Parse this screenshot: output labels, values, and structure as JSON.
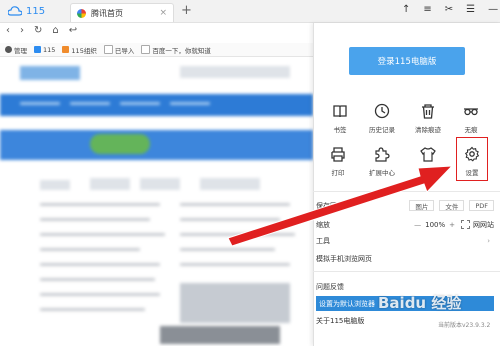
{
  "tabstrip": {
    "brand": "115",
    "tab_title": "腾讯首页",
    "tab_close": "×",
    "new_tab": "+",
    "window_controls": [
      "↑",
      "≡",
      "✂",
      "☰",
      "—"
    ]
  },
  "nav": {
    "back": "‹",
    "forward": "›",
    "reload": "↻",
    "home": "⌂",
    "undo": "↩"
  },
  "bookmarks": [
    {
      "label": "管理",
      "color": "#555555"
    },
    {
      "label": "115",
      "color": "#2d8cf0"
    },
    {
      "label": "115组织",
      "color": "#f08c2d"
    },
    {
      "label": "已导入",
      "color": "#bbbbbb"
    },
    {
      "label": "百度一下，你就知道",
      "color": "#bbbbbb"
    }
  ],
  "panel": {
    "login_button": "登录115电脑版",
    "tools_row1": [
      {
        "label": "书签",
        "icon": "book-icon"
      },
      {
        "label": "历史记录",
        "icon": "clock-icon"
      },
      {
        "label": "清除痕迹",
        "icon": "trash-icon"
      },
      {
        "label": "无痕",
        "icon": "incognito-icon"
      }
    ],
    "tools_row2": [
      {
        "label": "打印",
        "icon": "printer-icon"
      },
      {
        "label": "扩展中心",
        "icon": "puzzle-icon"
      },
      {
        "label": "皮肤",
        "icon": "shirt-icon"
      },
      {
        "label": "设置",
        "icon": "gear-icon"
      }
    ],
    "save_page": "保存网页",
    "save_formats": [
      "图片",
      "文件",
      "PDF"
    ],
    "zoom_label": "缩放",
    "zoom_minus": "—",
    "zoom_value": "100%",
    "zoom_plus": "+",
    "zoom_fullscreen_icon": "fullscreen-icon",
    "fullscreen_label": "网网站",
    "tools": "工具",
    "tools_chevron": "›",
    "mobile_browse": "模拟手机浏览网页",
    "feedback": "问题反馈",
    "set_default": "设置为默认浏览器",
    "about": "关于115电脑版",
    "version": "当前版本v23.9.3.2"
  },
  "watermark": "Baidu 经验",
  "colors": {
    "accent": "#2e8ad8",
    "login": "#4aa3ec",
    "highlight": "#e02020"
  }
}
